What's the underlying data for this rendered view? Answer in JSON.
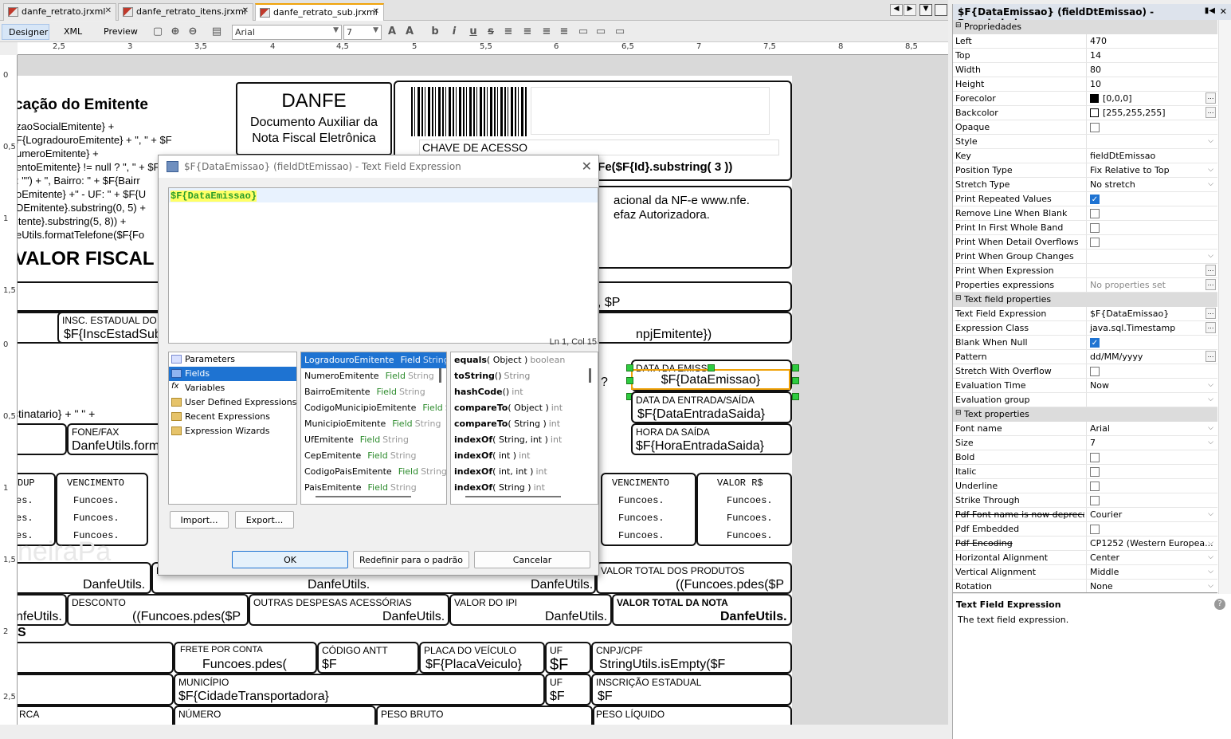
{
  "tabs": [
    {
      "label": "danfe_retrato.jrxml"
    },
    {
      "label": "danfe_retrato_itens.jrxml"
    },
    {
      "label": "danfe_retrato_sub.jrxml",
      "active": true
    }
  ],
  "views": [
    "Designer",
    "XML",
    "Preview"
  ],
  "font_combo": "Arial",
  "size_combo": "7",
  "ruler_h": [
    "2,5",
    "3",
    "3,5",
    "4",
    "4,5",
    "5",
    "5,5",
    "6",
    "6,5",
    "7",
    "7,5",
    "8",
    "8,5"
  ],
  "ruler_v": [
    "0",
    "0,5",
    "1",
    "1,5",
    "0",
    "0,5",
    "1",
    "1,5",
    "2",
    "2,5"
  ],
  "report": {
    "emit_title": "cação do Emitente",
    "emit_lines": [
      "zaoSocialEmitente} +",
      "F{LogradouroEmitente} + \", \" + $F",
      "umeroEmitente} +",
      "entoEmitente} != null ? \", \" + $F",
      ": \"\") + \", Bairro: \" + $F{Bairr",
      "oEmitente} +\" - UF: \" + $F{U",
      "DEmitente}.substring(0, 5) +",
      "itente}.substring(5, 8)) +",
      "eUtils.formatTelefone($F{Fo"
    ],
    "sem_valor": "VALOR FISCAL",
    "danfe_title": "DANFE",
    "danfe_sub1": "Documento Auxiliar da",
    "danfe_sub2": "Nota Fiscal Eletrônica",
    "chave_label": "CHAVE DE ACESSO",
    "chave_expr": "lFe($F{Id}.substring( 3 ))",
    "consulta1": "acional da NF-e www.nfe.",
    "consulta2": "efaz Autorizadora.",
    "f_p": ", $P",
    "insc_label": "INSC. ESTADUAL DO",
    "insc_val": "$F{InscEstadSub",
    "cnpj_val": "npjEmitente})",
    "data_emiss_label": "DATA DA EMISS",
    "data_emiss_val": "$F{DataEmissao}",
    "q_mark": "?",
    "data_es_label": "DATA DA ENTRADA/SAÍDA",
    "data_es_val": "$F{DataEntradaSaida}",
    "hora_label": "HORA DA SAÍDA",
    "hora_val": "$F{HoraEntradaSaida}",
    "dest_expr": "stinatario} + \" \" +",
    "fone_label": "FONE/FAX",
    "fone_val": "DanfeUtils.form",
    "dup": "DUP",
    "venc": "VENCIMENTO",
    "valor_rs": "VALOR R$",
    "es": "es.",
    "funcoes": "Funcoes.",
    "watermark": "neiraPa",
    "danfe_utils": "DanfeUtils.",
    "b_label": "B",
    "vtp_label": "VALOR TOTAL DOS PRODUTOS",
    "vtp_val": "((Funcoes.pdes($P",
    "desconto_label": "DESCONTO",
    "desconto_val": "((Funcoes.pdes($P",
    "outras_label": "OUTRAS DESPESAS ACESSÓRIAS",
    "ipi_label": "VALOR DO IPI",
    "vtn_label": "VALOR TOTAL DA NOTA",
    "nfe_utils": "nfeUtils.",
    "s_char": "S",
    "frete_label": "FRETE POR CONTA",
    "frete_val": "Funcoes.pdes(",
    "antt_label": "CÓDIGO ANTT",
    "f_short": "$F",
    "placa_label": "PLACA DO VEÍCULO",
    "placa_val": "$F{PlacaVeiculo}",
    "uf_label": "UF",
    "cnpj_label": "CNPJ/CPF",
    "cnpj_expr": "StringUtils.isEmpty($F",
    "municipio_label": "MUNICÍPIO",
    "municipio_val": "$F{CidadeTransportadora}",
    "ie_label": "INSCRIÇÃO ESTADUAL",
    "rca": "RCA",
    "numero_label": "NÚMERO",
    "peso_bruto": "PESO BRUTO",
    "peso_liquido": "PESO LÍQUIDO"
  },
  "dialog": {
    "title": "$F{DataEmissao} (fieldDtEmissao) - Text Field Expression",
    "expression": "$F{DataEmissao}",
    "cursor": "Ln 1, Col 15",
    "categories": [
      "Parameters",
      "Fields",
      "Variables",
      "User Defined Expressions",
      "Recent Expressions",
      "Expression Wizards"
    ],
    "fields": [
      {
        "name": "LogradouroEmitente",
        "type": "String"
      },
      {
        "name": "NumeroEmitente",
        "type": "String"
      },
      {
        "name": "BairroEmitente",
        "type": "String"
      },
      {
        "name": "CodigoMunicipioEmitente",
        "type": "St"
      },
      {
        "name": "MunicipioEmitente",
        "type": "String"
      },
      {
        "name": "UfEmitente",
        "type": "String"
      },
      {
        "name": "CepEmitente",
        "type": "String"
      },
      {
        "name": "CodigoPaisEmitente",
        "type": "String"
      },
      {
        "name": "PaisEmitente",
        "type": "String"
      }
    ],
    "field_word": "Field",
    "methods": [
      {
        "name": "equals",
        "args": "( Object )",
        "ret": "boolean"
      },
      {
        "name": "toString",
        "args": "()",
        "ret": "String"
      },
      {
        "name": "hashCode",
        "args": "()",
        "ret": "int"
      },
      {
        "name": "compareTo",
        "args": "( Object )",
        "ret": "int"
      },
      {
        "name": "compareTo",
        "args": "( String )",
        "ret": "int"
      },
      {
        "name": "indexOf",
        "args": "( String, int )",
        "ret": "int"
      },
      {
        "name": "indexOf",
        "args": "( int )",
        "ret": "int"
      },
      {
        "name": "indexOf",
        "args": "( int, int )",
        "ret": "int"
      },
      {
        "name": "indexOf",
        "args": "( String )",
        "ret": "int"
      }
    ],
    "import_label": "Import...",
    "export_label": "Export...",
    "ok_label": "OK",
    "reset_label": "Redefinir para o padrão",
    "cancel_label": "Cancelar"
  },
  "properties": {
    "title": "$F{DataEmissao} (fieldDtEmissao) - Propriedades",
    "sections": {
      "propriedades": "Propriedades",
      "text_field": "Text field properties",
      "text": "Text properties"
    },
    "rows_a": [
      {
        "k": "Left",
        "v": "470"
      },
      {
        "k": "Top",
        "v": "14"
      },
      {
        "k": "Width",
        "v": "80"
      },
      {
        "k": "Height",
        "v": "10"
      },
      {
        "k": "Forecolor",
        "v": "[0,0,0]",
        "color": "#000000",
        "ell": true
      },
      {
        "k": "Backcolor",
        "v": "[255,255,255]",
        "color": "#ffffff",
        "ell": true
      },
      {
        "k": "Opaque",
        "check": false
      },
      {
        "k": "Style",
        "v": "",
        "dd": true
      },
      {
        "k": "Key",
        "v": "fieldDtEmissao"
      },
      {
        "k": "Position Type",
        "v": "Fix Relative to Top",
        "dd": true
      },
      {
        "k": "Stretch Type",
        "v": "No stretch",
        "dd": true
      },
      {
        "k": "Print Repeated Values",
        "check": true
      },
      {
        "k": "Remove Line When Blank",
        "check": false
      },
      {
        "k": "Print In First Whole Band",
        "check": false
      },
      {
        "k": "Print When Detail Overflows",
        "check": false
      },
      {
        "k": "Print When Group Changes",
        "v": "",
        "dd": true
      },
      {
        "k": "Print When Expression",
        "v": "",
        "ell": true
      },
      {
        "k": "Properties expressions",
        "v": "No properties set",
        "ell": true,
        "grey": true
      }
    ],
    "rows_b": [
      {
        "k": "Text Field Expression",
        "v": "$F{DataEmissao}",
        "ell": true
      },
      {
        "k": "Expression Class",
        "v": "java.sql.Timestamp",
        "dd": true,
        "ell": true
      },
      {
        "k": "Blank When Null",
        "check": true
      },
      {
        "k": "Pattern",
        "v": "dd/MM/yyyy",
        "ell": true
      },
      {
        "k": "Stretch With Overflow",
        "check": false
      },
      {
        "k": "Evaluation Time",
        "v": "Now",
        "dd": true
      },
      {
        "k": "Evaluation group",
        "v": "",
        "dd": true
      }
    ],
    "rows_c": [
      {
        "k": "Font name",
        "v": "Arial",
        "dd": true
      },
      {
        "k": "Size",
        "v": "7",
        "dd": true
      },
      {
        "k": "Bold",
        "check": false
      },
      {
        "k": "Italic",
        "check": false
      },
      {
        "k": "Underline",
        "check": false
      },
      {
        "k": "Strike Through",
        "check": false
      },
      {
        "k": "Pdf Font name is now deprecated",
        "v": "Courier",
        "dd": true,
        "strike": true
      },
      {
        "k": "Pdf Embedded",
        "check": false
      },
      {
        "k": "Pdf Encoding",
        "v": "CP1252 (Western Europea...",
        "dd": true,
        "strike": true
      },
      {
        "k": "Horizontal Alignment",
        "v": "Center",
        "dd": true
      },
      {
        "k": "Vertical Alignment",
        "v": "Middle",
        "dd": true
      },
      {
        "k": "Rotation",
        "v": "None",
        "dd": true
      }
    ],
    "help_title": "Text Field Expression",
    "help_text": "The text field expression."
  }
}
